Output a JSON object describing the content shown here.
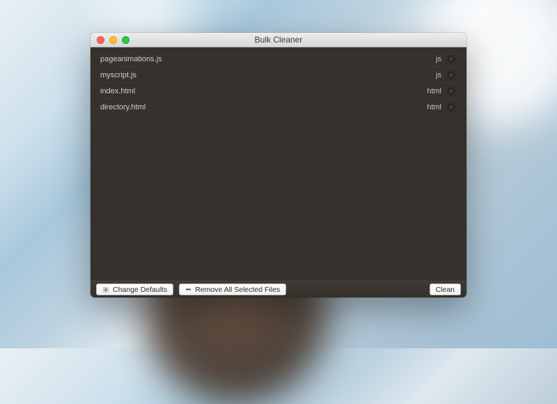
{
  "window": {
    "title": "Bulk Cleaner"
  },
  "files": [
    {
      "name": "pageanimations.js",
      "ext": "js"
    },
    {
      "name": "myscript.js",
      "ext": "js"
    },
    {
      "name": "index.html",
      "ext": "html"
    },
    {
      "name": "directory.html",
      "ext": "html"
    }
  ],
  "toolbar": {
    "change_defaults": "Change Defaults",
    "remove_all": "Remove All Selected Files",
    "clean": "Clean"
  }
}
